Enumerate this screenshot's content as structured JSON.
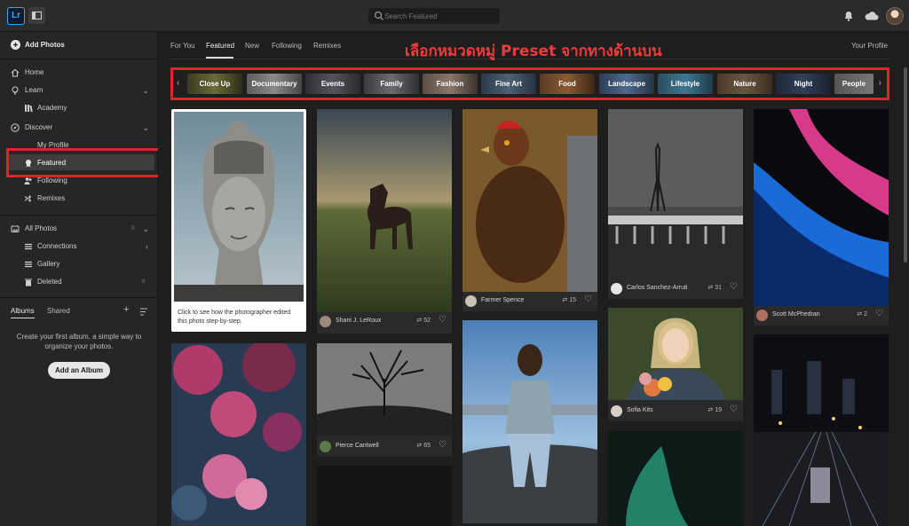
{
  "app": {
    "logo": "Lr"
  },
  "search": {
    "placeholder": "Search Featured"
  },
  "sidebar": {
    "add_photos": "Add Photos",
    "home": "Home",
    "learn": "Learn",
    "academy": "Academy",
    "discover": "Discover",
    "my_profile": "My Profile",
    "featured": "Featured",
    "following": "Following",
    "remixes": "Remixes",
    "all_photos": "All Photos",
    "connections": "Connections",
    "gallery": "Gallery",
    "deleted": "Deleted",
    "all_photos_count": "0",
    "deleted_count": "0"
  },
  "albums": {
    "tab_albums": "Albums",
    "tab_shared": "Shared",
    "empty_message": "Create your first album, a simple way to organize your photos.",
    "add_button": "Add an Album"
  },
  "nav": {
    "tabs": [
      "For You",
      "Featured",
      "New",
      "Following",
      "Remixes"
    ],
    "your_profile": "Your Profile"
  },
  "annotation": "เลือกหมวดหมู่ Preset จากทางด้านบน",
  "categories": [
    "Close Up",
    "Documentary",
    "Events",
    "Family",
    "Fashion",
    "Fine Art",
    "Food",
    "Landscape",
    "Lifestyle",
    "Nature",
    "Night",
    "People"
  ],
  "buddha": {
    "caption": "Click to see how the photographer edited this photo step-by-step."
  },
  "photos": [
    {
      "name": "Shani J. LeRoux",
      "remixes": "52"
    },
    {
      "name": "Farmer Spence",
      "remixes": "15"
    },
    {
      "name": "Carlos Sanchez-Arruti",
      "remixes": "31"
    },
    {
      "name": "Scott McPhedran",
      "remixes": "2"
    },
    {
      "name": "Pierce Cantwell",
      "remixes": "65"
    },
    {
      "name": "Sofia Kits",
      "remixes": "19"
    }
  ],
  "colors": {
    "accent_red": "#e0242d",
    "lr_blue": "#31a8ff"
  }
}
